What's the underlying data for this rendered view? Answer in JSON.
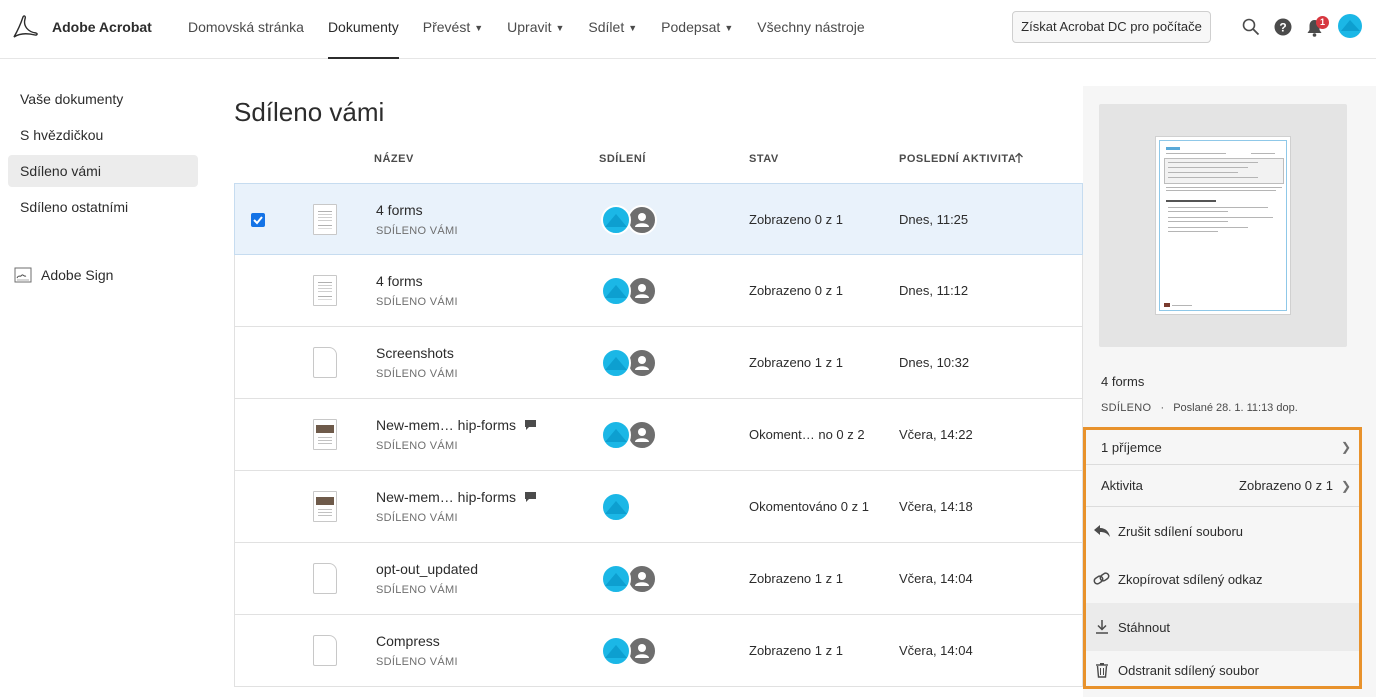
{
  "app": {
    "brand": "Adobe Acrobat"
  },
  "nav": {
    "items": [
      {
        "label": "Domovská stránka",
        "dropdown": false,
        "active": false
      },
      {
        "label": "Dokumenty",
        "dropdown": false,
        "active": true
      },
      {
        "label": "Převést",
        "dropdown": true,
        "active": false
      },
      {
        "label": "Upravit",
        "dropdown": true,
        "active": false
      },
      {
        "label": "Sdílet",
        "dropdown": true,
        "active": false
      },
      {
        "label": "Podepsat",
        "dropdown": true,
        "active": false
      },
      {
        "label": "Všechny nástroje",
        "dropdown": false,
        "active": false
      }
    ],
    "get_button": "Získat Acrobat DC pro počítače",
    "notification_count": "1",
    "icons": [
      "search-icon",
      "help-icon",
      "bell-icon",
      "avatar"
    ]
  },
  "sidebar": {
    "items": [
      {
        "label": "Vaše dokumenty",
        "active": false
      },
      {
        "label": "S hvězdičkou",
        "active": false
      },
      {
        "label": "Sdíleno vámi",
        "active": true
      },
      {
        "label": "Sdíleno ostatními",
        "active": false
      }
    ],
    "sign": "Adobe Sign"
  },
  "main": {
    "title": "Sdíleno vámi",
    "columns": {
      "name": "NÁZEV",
      "sharing": "SDÍLENÍ",
      "status": "STAV",
      "activity": "POSLEDNÍ AKTIVITA",
      "sort_icon": "arrow-up-icon"
    },
    "rows": [
      {
        "name": "4 forms",
        "sub": "SDÍLENO VÁMI",
        "status": "Zobrazeno 0 z 1",
        "activity": "Dnes, 11:25",
        "thumb": "doc",
        "selected": true,
        "comment": false,
        "avatars": 2
      },
      {
        "name": "4 forms",
        "sub": "SDÍLENO VÁMI",
        "status": "Zobrazeno 0 z 1",
        "activity": "Dnes, 11:12",
        "thumb": "doc",
        "selected": false,
        "comment": false,
        "avatars": 2
      },
      {
        "name": "Screenshots",
        "sub": "SDÍLENO VÁMI",
        "status": "Zobrazeno 1 z 1",
        "activity": "Dnes, 10:32",
        "thumb": "blank",
        "selected": false,
        "comment": false,
        "avatars": 2
      },
      {
        "name": "New-mem… hip-forms",
        "sub": "SDÍLENO VÁMI",
        "status": "Okoment… no 0 z 2",
        "activity": "Včera, 14:22",
        "thumb": "img",
        "selected": false,
        "comment": true,
        "avatars": 2
      },
      {
        "name": "New-mem… hip-forms",
        "sub": "SDÍLENO VÁMI",
        "status": "Okomentováno 0 z 1",
        "activity": "Včera, 14:18",
        "thumb": "img",
        "selected": false,
        "comment": true,
        "avatars": 1
      },
      {
        "name": "opt-out_updated",
        "sub": "SDÍLENO VÁMI",
        "status": "Zobrazeno 1 z 1",
        "activity": "Včera, 14:04",
        "thumb": "blank",
        "selected": false,
        "comment": false,
        "avatars": 2
      },
      {
        "name": "Compress",
        "sub": "SDÍLENO VÁMI",
        "status": "Zobrazeno 1 z 1",
        "activity": "Včera, 14:04",
        "thumb": "blank",
        "selected": false,
        "comment": false,
        "avatars": 2
      }
    ]
  },
  "detail": {
    "name": "4 forms",
    "shared_label": "SDÍLENO",
    "sent": "Poslané 28. 1. 11:13 dop.",
    "recipients": "1 příjemce",
    "activity_label": "Aktivita",
    "activity_value": "Zobrazeno 0 z 1",
    "actions": [
      {
        "label": "Zrušit sdílení souboru",
        "icon": "unshare-icon"
      },
      {
        "label": "Zkopírovat sdílený odkaz",
        "icon": "link-icon"
      },
      {
        "label": "Stáhnout",
        "icon": "download-icon"
      },
      {
        "label": "Odstranit sdílený soubor",
        "icon": "trash-icon"
      }
    ],
    "highlight_color": "#e8922c"
  },
  "colors": {
    "accent": "#1473e6",
    "avatar": "#1bb7e6",
    "badge": "#d7373f"
  }
}
